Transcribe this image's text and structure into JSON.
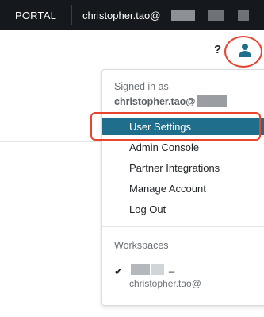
{
  "topbar": {
    "portal_label": "PORTAL",
    "user_label": "christopher.tao@"
  },
  "header": {
    "help_label": "?",
    "avatar_icon": "user-icon"
  },
  "menu": {
    "signed_in_label": "Signed in as",
    "signed_in_user": "christopher.tao@",
    "items": [
      {
        "label": "User Settings",
        "active": true
      },
      {
        "label": "Admin Console"
      },
      {
        "label": "Partner Integrations"
      },
      {
        "label": "Manage Account"
      },
      {
        "label": "Log Out"
      }
    ],
    "workspaces_label": "Workspaces",
    "workspace": {
      "name": "_",
      "email": "christopher.tao@"
    }
  },
  "colors": {
    "topbar_bg": "#15181c",
    "active_item_bg": "#1f6e8c",
    "highlight": "#e8442e",
    "avatar": "#1f6e8c"
  }
}
